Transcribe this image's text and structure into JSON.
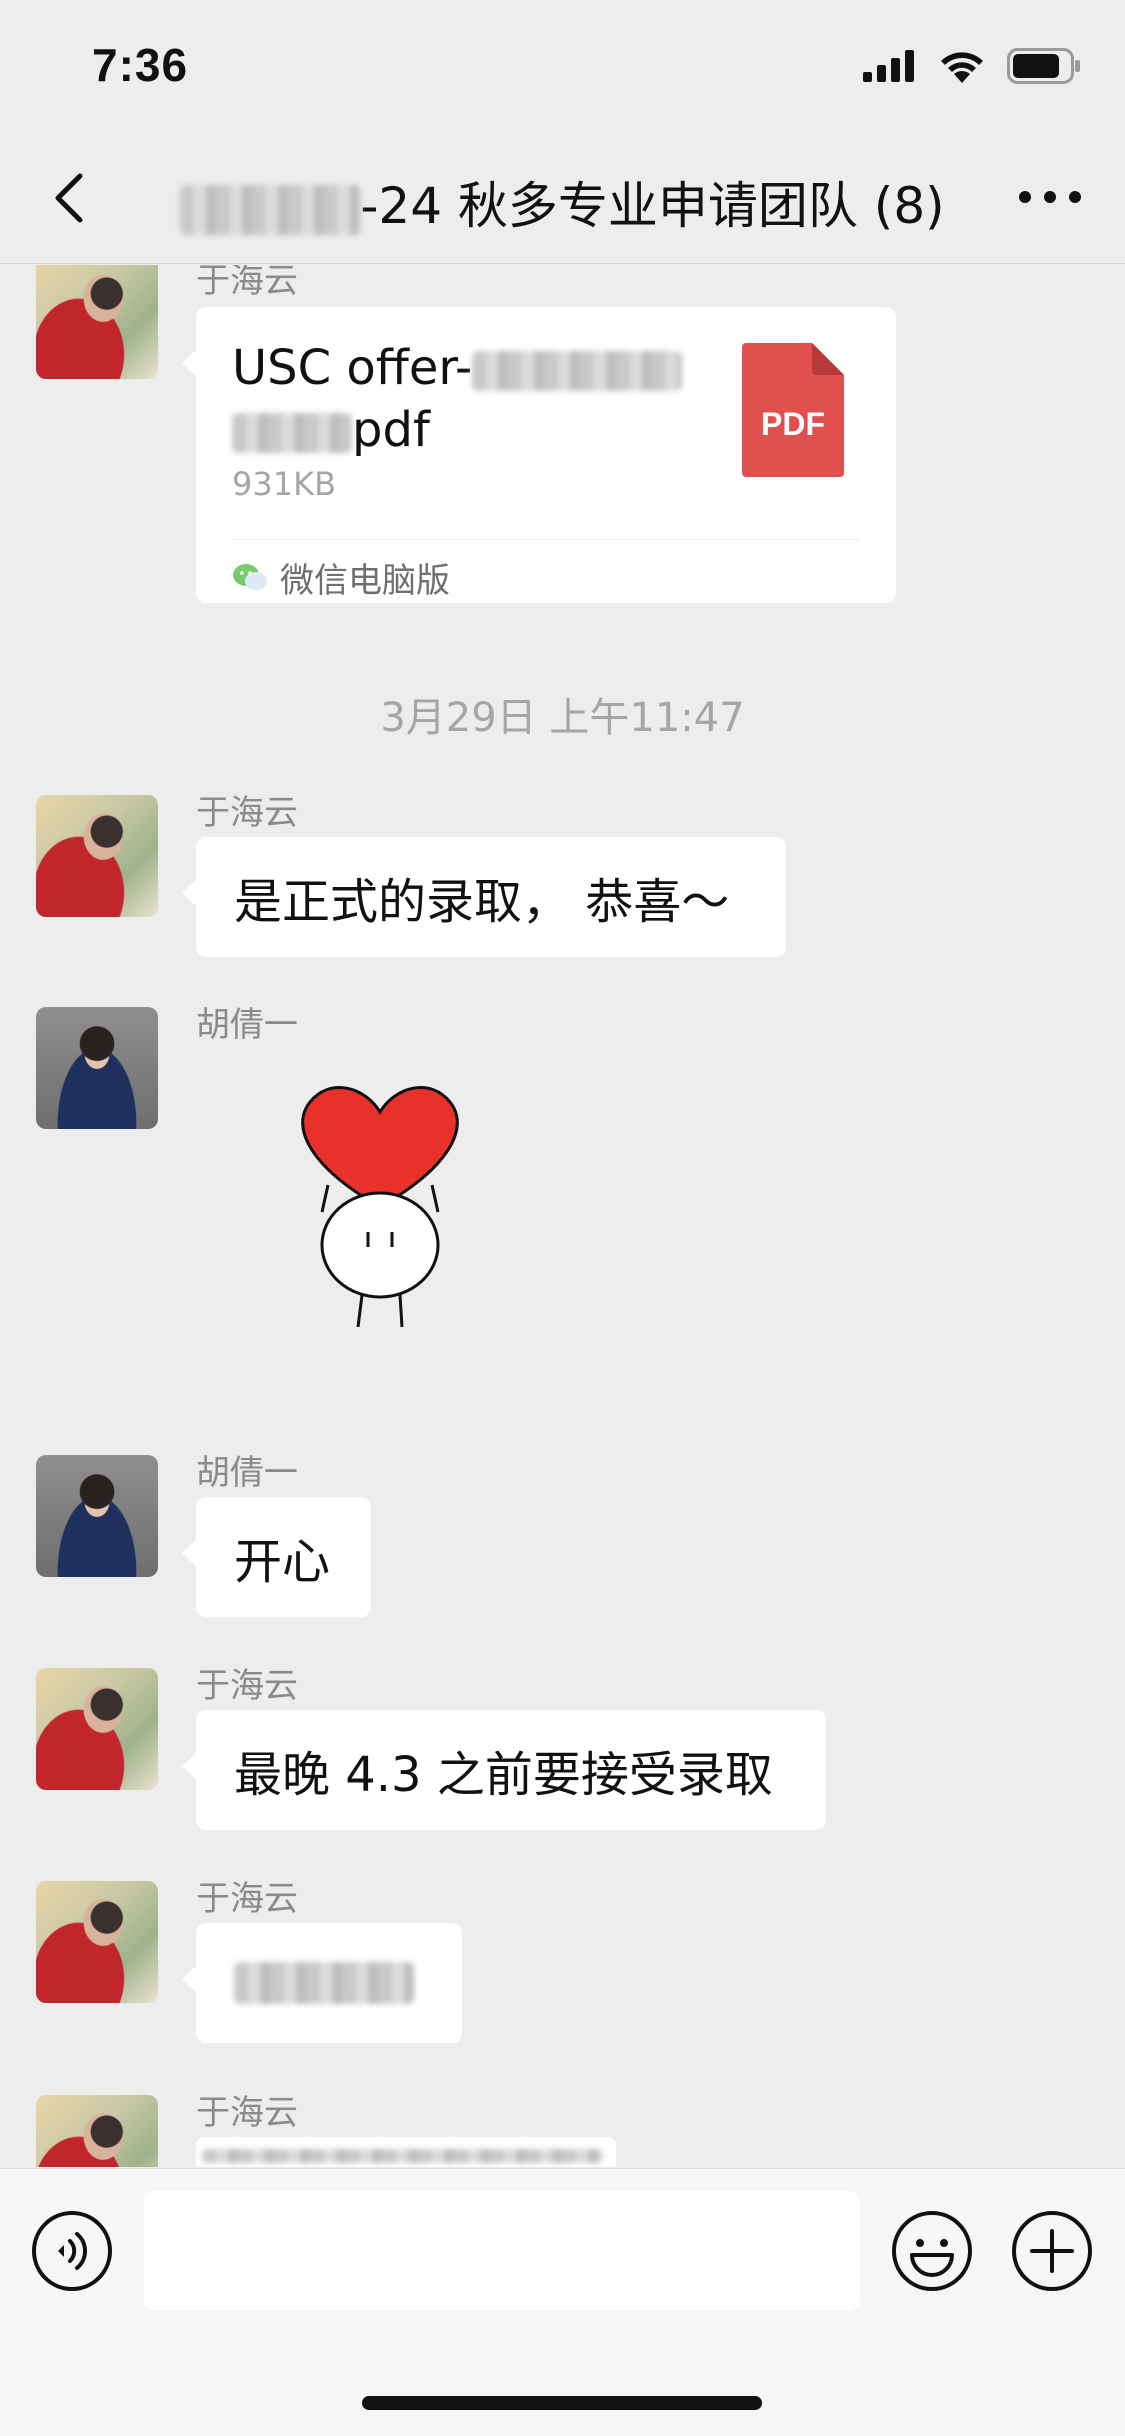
{
  "status": {
    "time": "7:36"
  },
  "nav": {
    "title_suffix": "-24 秋多专业申请团队 (8)",
    "back_icon": "chevron-left-icon",
    "more_icon": "more-dots-icon"
  },
  "messages": [
    {
      "sender": "于海云",
      "file": {
        "name_prefix": "USC offer-",
        "name_suffix": "pdf",
        "size": "931KB",
        "type_label": "PDF",
        "source": "微信电脑版"
      }
    },
    {
      "timestamp": "3月29日 上午11:47"
    },
    {
      "sender": "于海云",
      "text": "是正式的录取， 恭喜～"
    },
    {
      "sender": "胡倩一",
      "sticker": "heart-sticker"
    },
    {
      "sender": "胡倩一",
      "text": "开心"
    },
    {
      "sender": "于海云",
      "text": "最晚 4.3 之前要接受录取"
    },
    {
      "sender": "于海云",
      "text": ""
    },
    {
      "sender": "于海云"
    }
  ],
  "input_bar": {
    "voice_icon": "voice-icon",
    "emoji_icon": "emoji-icon",
    "plus_icon": "plus-icon"
  },
  "colors": {
    "background": "#ededed",
    "bubble": "#ffffff",
    "pdf_red": "#e0504f",
    "sticker_red": "#e8312a"
  }
}
